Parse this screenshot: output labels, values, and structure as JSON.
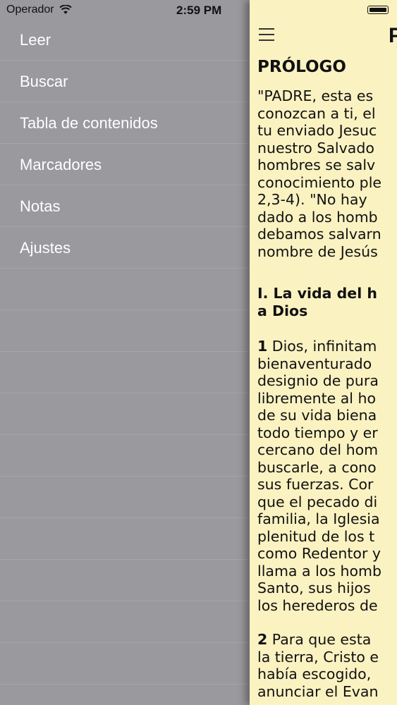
{
  "status_bar": {
    "carrier": "Operador",
    "time": "2:59 PM"
  },
  "menu": {
    "items": [
      {
        "label": "Leer"
      },
      {
        "label": "Buscar"
      },
      {
        "label": "Tabla de contenidos"
      },
      {
        "label": "Marcadores"
      },
      {
        "label": "Notas"
      },
      {
        "label": "Ajustes"
      }
    ]
  },
  "reader": {
    "title": "P",
    "prologue_heading": "PRÓLOGO",
    "prologue_lines": [
      "\"PADRE, esta es",
      "conozcan a ti, el",
      "tu enviado Jesuc",
      "nuestro Salvado",
      "hombres se salv",
      "conocimiento ple",
      "2,3-4). \"No hay",
      "dado a los homb",
      "debamos salvarn",
      "nombre de Jesús"
    ],
    "section_heading_lines": [
      "I. La vida del h",
      "a Dios"
    ],
    "para1_num": "1",
    "para1_first": " Dios, infinitam",
    "para1_lines": [
      "bienaventurado",
      "designio de pura",
      "libremente al ho",
      "de su vida biena",
      "todo tiempo y er",
      "cercano del hom",
      "buscarle, a cono",
      "sus fuerzas. Cor",
      "que el pecado di",
      "familia, la Iglesia",
      "plenitud de los t",
      "como Redentor y",
      "llama a los homb",
      "Santo, sus hijos",
      "los herederos de"
    ],
    "para2_num": "2",
    "para2_first": " Para que esta",
    "para2_lines": [
      "la tierra, Cristo e",
      "había escogido,",
      "anunciar el Evan"
    ]
  },
  "colors": {
    "menu_background": "#9a999e",
    "reader_background": "#fbf2c2",
    "menu_text": "#ffffff"
  },
  "icons": [
    "wifi-icon",
    "battery-icon",
    "hamburger-menu-icon"
  ]
}
